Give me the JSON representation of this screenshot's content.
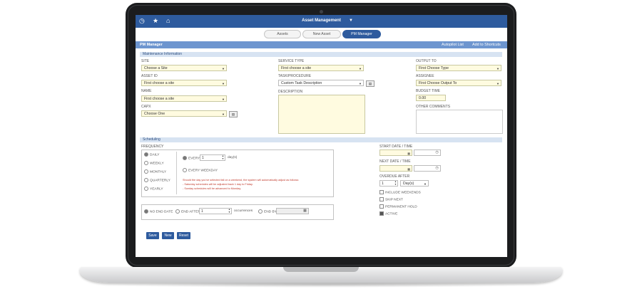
{
  "app": {
    "title": "Asset Management",
    "nav_icons": [
      "clock-icon",
      "star-icon",
      "home-icon"
    ],
    "accent_color": "#2e5b9e"
  },
  "tabs": [
    {
      "label": "Assets",
      "active": false
    },
    {
      "label": "New Asset",
      "active": false
    },
    {
      "label": "PM Manager",
      "active": true
    }
  ],
  "pm_bar": {
    "title": "PM Manager",
    "autopilot_link": "Autopilot List",
    "shortcuts_link": "Add to Shortcuts"
  },
  "maintenance": {
    "section_title": "Maintenance Information",
    "site": {
      "label": "SITE",
      "value": "Choose a Site"
    },
    "asset_id": {
      "label": "ASSET ID",
      "value": "First choose a site"
    },
    "name": {
      "label": "NAME",
      "value": "First choose a site"
    },
    "capx": {
      "label": "CAPX",
      "value": "Choose One"
    },
    "service_type": {
      "label": "SERVICE TYPE",
      "value": "First choose a site"
    },
    "task_procedure": {
      "label": "TASK/PROCEDURE",
      "value": "Custom Task Description"
    },
    "description": {
      "label": "DESCRIPTION",
      "value": ""
    },
    "output_to": {
      "label": "OUTPUT TO",
      "value": "First Choose Type"
    },
    "assignee": {
      "label": "ASSIGNEE",
      "value": "First Choose Output To"
    },
    "budget_time": {
      "label": "BUDGET TIME",
      "value": "0.00"
    },
    "other_comments": {
      "label": "OTHER COMMENTS",
      "value": ""
    }
  },
  "scheduling": {
    "section_title": "Scheduling",
    "frequency_label": "FREQUENCY",
    "frequency_options": [
      "DAILY",
      "WEEKLY",
      "MONTHLY",
      "QUARTERLY",
      "YEARLY"
    ],
    "selected_frequency": "DAILY",
    "every_label": "EVERY",
    "every_value": "1",
    "days_label": "day(s)",
    "every_weekday_label": "EVERY WEEKDAY",
    "notes": [
      "Should the day you've selected fall on a weekend, the system will automatically adjust as follows:",
      "- Saturday schedules will be adjusted back 1 day to Friday.",
      "- Sunday schedules will be advanced to Monday."
    ],
    "end_options": {
      "no_end_date": "NO END DATE",
      "end_after": "END AFTER",
      "end_after_value": "1",
      "occurrences": "occurrences",
      "end_by": "END BY"
    },
    "start_label": "START DATE / TIME",
    "next_label": "NEXT DATE / TIME",
    "overdue_label": "OVERDUE AFTER",
    "overdue_value": "1",
    "overdue_unit": "Day(s)",
    "checkboxes": [
      {
        "label": "INCLUDE WEEKENDS",
        "checked": false
      },
      {
        "label": "SKIP NEXT",
        "checked": false
      },
      {
        "label": "PERMANENT HOLD",
        "checked": false
      },
      {
        "label": "ACTIVE",
        "checked": true
      }
    ]
  },
  "actions": {
    "save": "Save",
    "new": "New",
    "reset": "Reset"
  }
}
